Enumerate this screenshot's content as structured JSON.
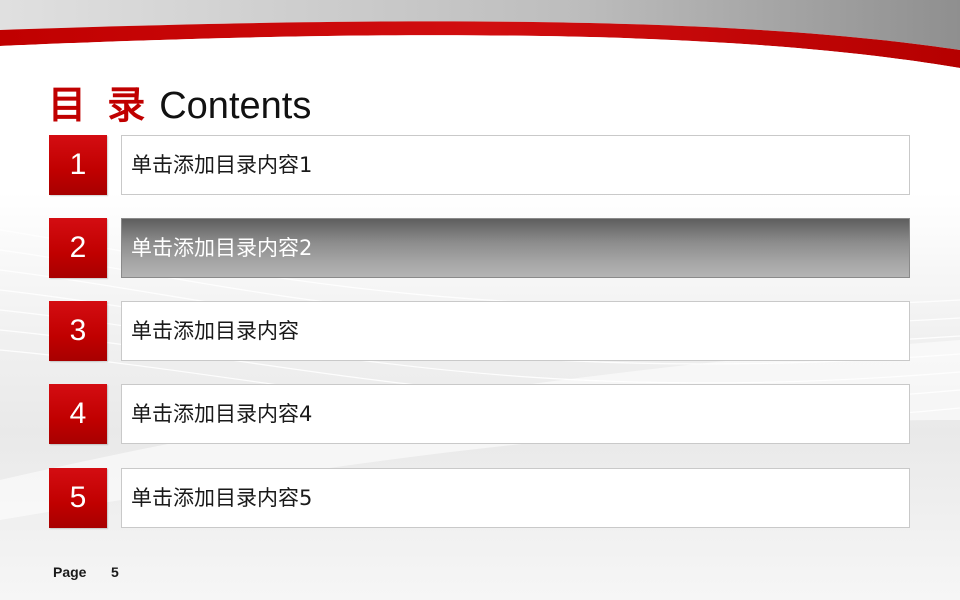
{
  "theme": {
    "accent": "#c00000",
    "highlight_gradient": [
      "#5e5e5e",
      "#b4b4b4"
    ],
    "decoration": "red-and-gray-swoosh-header"
  },
  "title": {
    "chinese": "目 录",
    "english": "Contents"
  },
  "toc": {
    "active_index": 2,
    "items": [
      {
        "number": "1",
        "label": "单击添加目录内容1"
      },
      {
        "number": "2",
        "label": "单击添加目录内容2"
      },
      {
        "number": "3",
        "label": "单击添加目录内容"
      },
      {
        "number": "4",
        "label": "单击添加目录内容4"
      },
      {
        "number": "5",
        "label": "单击添加目录内容5"
      }
    ]
  },
  "footer": {
    "page_label": "Page",
    "page_number": "5"
  }
}
